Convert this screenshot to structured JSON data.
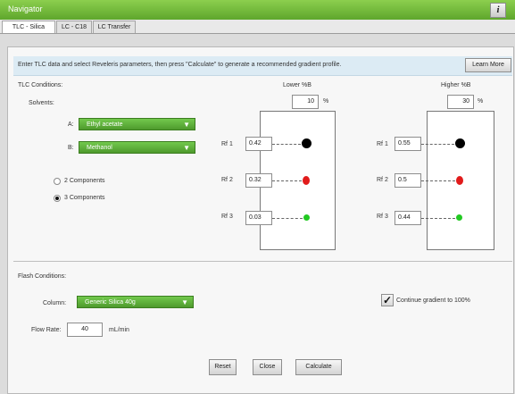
{
  "window": {
    "title": "Navigator",
    "help_label": "i"
  },
  "tabs": [
    {
      "label": "TLC - Silica"
    },
    {
      "label": "LC - C18"
    },
    {
      "label": "LC Transfer"
    }
  ],
  "info": {
    "text": "Enter TLC data and select Reveleris parameters, then press \"Calculate\" to generate a recommended gradient profile.",
    "learn_more": "Learn More"
  },
  "tlc": {
    "section_label": "TLC Conditions:",
    "solvents_label": "Solvents:",
    "solvent_a": {
      "label": "A:",
      "value": "Ethyl acetate"
    },
    "solvent_b": {
      "label": "B:",
      "value": "Methanol"
    },
    "components": [
      {
        "label": "2 Components",
        "selected": false
      },
      {
        "label": "3 Components",
        "selected": true
      }
    ],
    "lower": {
      "title": "Lower %B",
      "value": "10",
      "unit": "%",
      "rf": [
        {
          "label": "Rf 1",
          "value": "0.42",
          "color": "#000000"
        },
        {
          "label": "Rf 2",
          "value": "0.32",
          "color": "#e11b1b"
        },
        {
          "label": "Rf 3",
          "value": "0.03",
          "color": "#22c922"
        }
      ]
    },
    "higher": {
      "title": "Higher %B",
      "value": "30",
      "unit": "%",
      "rf": [
        {
          "label": "Rf 1",
          "value": "0.55",
          "color": "#000000"
        },
        {
          "label": "Rf 2",
          "value": "0.5",
          "color": "#e11b1b"
        },
        {
          "label": "Rf 3",
          "value": "0.44",
          "color": "#22c922"
        }
      ]
    }
  },
  "flash": {
    "section_label": "Flash Conditions:",
    "column_label": "Column:",
    "column_value": "Generic Silica 40g",
    "continue_label": "Continue gradient to 100%",
    "flow_label": "Flow Rate:",
    "flow_value": "40",
    "flow_unit": "mL/min"
  },
  "buttons": {
    "reset": "Reset",
    "close": "Close",
    "calculate": "Calculate"
  },
  "colors": {
    "title_green": "#6ab533",
    "dropdown_green": "#5ca83a",
    "info_blue": "#dcebf4"
  }
}
